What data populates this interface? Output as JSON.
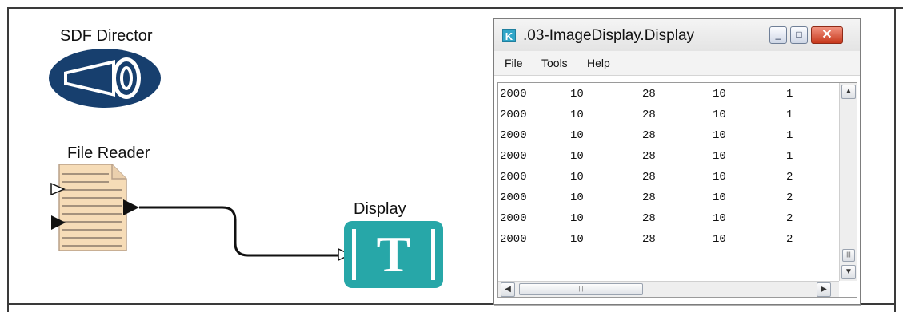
{
  "canvas": {
    "director_label": "SDF Director",
    "reader_label": "File Reader",
    "display_label": "Display",
    "display_glyph": "T",
    "colors": {
      "director": "#173f6e",
      "display": "#27a7a8",
      "reader_paper": "#f6dcb7",
      "frame": "#3a3a3a"
    }
  },
  "window": {
    "app_icon_letter": "K",
    "title": ".03-ImageDisplay.Display",
    "controls": {
      "minimize": "_",
      "maximize": "□",
      "close": "✕"
    },
    "menu": [
      {
        "label": "File"
      },
      {
        "label": "Tools"
      },
      {
        "label": "Help"
      }
    ],
    "rows": [
      [
        "2000",
        "10",
        "28",
        "10",
        "1"
      ],
      [
        "2000",
        "10",
        "28",
        "10",
        "1"
      ],
      [
        "2000",
        "10",
        "28",
        "10",
        "1"
      ],
      [
        "2000",
        "10",
        "28",
        "10",
        "1"
      ],
      [
        "2000",
        "10",
        "28",
        "10",
        "2"
      ],
      [
        "2000",
        "10",
        "28",
        "10",
        "2"
      ],
      [
        "2000",
        "10",
        "28",
        "10",
        "2"
      ],
      [
        "2000",
        "10",
        "28",
        "10",
        "2"
      ]
    ],
    "scroll": {
      "up": "▲",
      "down": "▼",
      "left": "◀",
      "right": "▶",
      "grip": "|||"
    }
  }
}
